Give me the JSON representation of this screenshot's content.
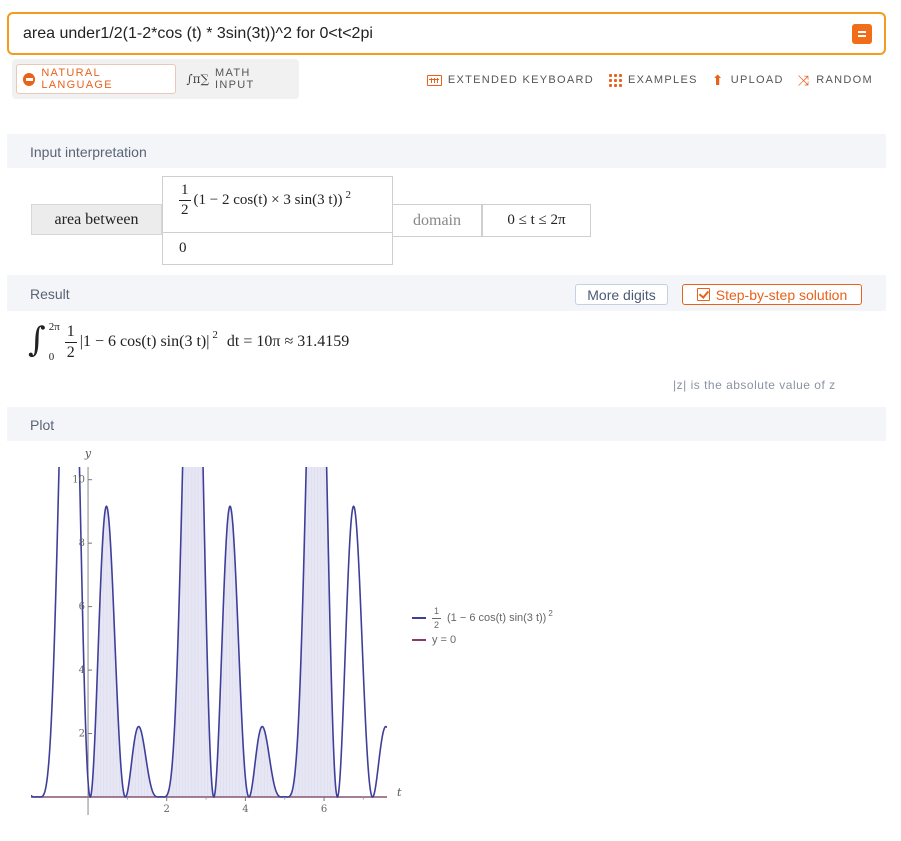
{
  "search": {
    "query": "area under1/2(1-2*cos (t) * 3sin(3t))^2 for 0<t<2pi"
  },
  "modes": {
    "natural_language": "NATURAL LANGUAGE",
    "math_input": "MATH INPUT"
  },
  "toolbar": {
    "extended_keyboard": "EXTENDED KEYBOARD",
    "examples": "EXAMPLES",
    "upload": "UPLOAD",
    "random": "RANDOM"
  },
  "pods": {
    "input": {
      "title": "Input interpretation",
      "label": "area between",
      "f_num": "1",
      "f_den": "2",
      "f_rest": "(1 − 2 cos(t) × 3 sin(3 t))",
      "f_exp": "2",
      "g": "0",
      "domain_label": "domain",
      "domain_value": "0 ≤ t ≤ 2π"
    },
    "result": {
      "title": "Result",
      "more_digits": "More digits",
      "step_by_step": "Step-by-step solution",
      "int_upper": "2π",
      "int_lower": "0",
      "frac_num": "1",
      "frac_den": "2",
      "integrand": "|1 − 6 cos(t) sin(3 t)|",
      "integrand_exp": "2",
      "equals": "dt = 10π ≈ 31.4159",
      "note": "|z| is the absolute value of z"
    },
    "plot": {
      "title": "Plot",
      "legend_1": "(1 − 6 cos(t) sin(3 t))",
      "legend_1_frac": "1/2",
      "legend_1_exp": "2",
      "legend_2": "y = 0"
    }
  },
  "chart_data": {
    "type": "line",
    "xlabel": "t",
    "ylabel": "y",
    "xlim": [
      -1.45,
      7.6
    ],
    "ylim": [
      0,
      10.4
    ],
    "x_ticks": [
      2,
      4,
      6
    ],
    "y_ticks": [
      2,
      4,
      6,
      8,
      10
    ],
    "series": [
      {
        "name": "1/2 (1 − 6 cos(t) sin(3 t))^2",
        "function": "0.5*(1-6*cos(t)*sin(3*t))^2",
        "color": "#3f3f9a",
        "shaded_from": 0,
        "shaded_to": 6.2832
      },
      {
        "name": "y = 0",
        "function": "0",
        "color": "#8a3a6a"
      }
    ],
    "fill_color": "#e6e6f4"
  },
  "colors": {
    "accent": "#e8621c",
    "search_border": "#f59b1b",
    "pod_header_bg": "#f3f5f8"
  }
}
